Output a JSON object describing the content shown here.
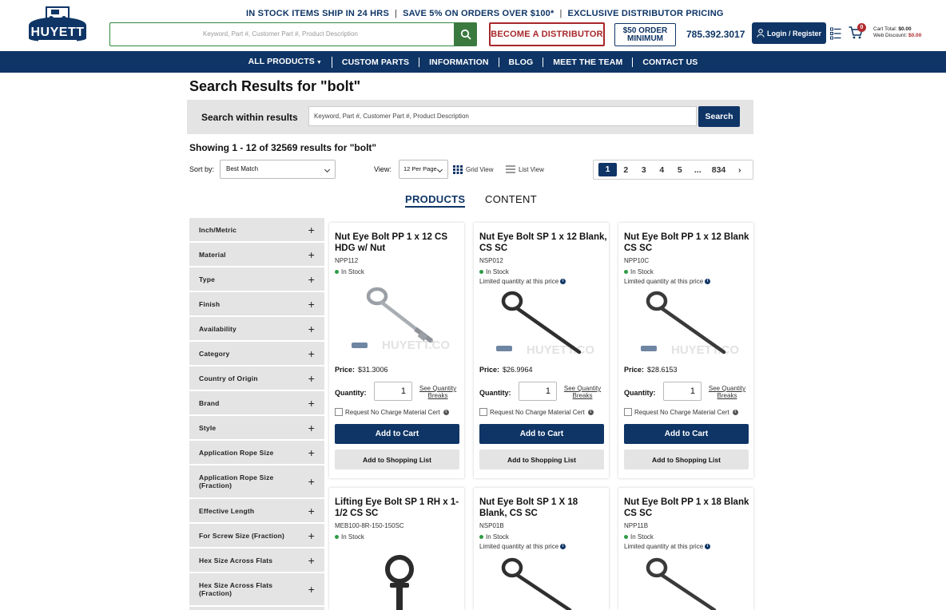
{
  "promo": {
    "item1": "IN STOCK ITEMS SHIP IN 24 HRS",
    "item2": "SAVE 5% ON ORDERS OVER $100*",
    "item3": "EXCLUSIVE DISTRIBUTOR PRICING",
    "sep": "|"
  },
  "header": {
    "search_placeholder": "Keyword, Part #, Customer Part #, Product Description",
    "become_distributor": "BECOME A DISTRIBUTOR",
    "order_min_line1": "$50 ORDER",
    "order_min_line2": "MINIMUM",
    "phone": "785.392.3017",
    "login": "Login / Register",
    "cart_count": "0",
    "cart_total_label": "Cart Total:",
    "cart_total": "$0.00",
    "web_discount_label": "Web Discount:",
    "web_discount": "$0.00"
  },
  "nav": {
    "items": [
      "ALL PRODUCTS",
      "CUSTOM PARTS",
      "INFORMATION",
      "BLOG",
      "MEET THE TEAM",
      "CONTACT US"
    ]
  },
  "page": {
    "title": "Search Results for \"bolt\"",
    "within_label": "Search within results",
    "within_placeholder": "Keyword, Part #, Customer Part #, Product Description",
    "within_button": "Search",
    "showing": "Showing 1 - 12 of 32569 results for \"bolt\"",
    "sort_label": "Sort by:",
    "sort_value": "Best Match",
    "view_label": "View:",
    "per_page": "12 Per Page",
    "grid_view": "Grid View",
    "list_view": "List View",
    "pages": [
      "1",
      "2",
      "3",
      "4",
      "5",
      "...",
      "834"
    ],
    "next": "›",
    "tab_products": "PRODUCTS",
    "tab_content": "CONTENT"
  },
  "filters": [
    "Inch/Metric",
    "Material",
    "Type",
    "Finish",
    "Availability",
    "Category",
    "Country of Origin",
    "Brand",
    "Style",
    "Application Rope Size",
    "Application Rope Size (Fraction)",
    "Effective Length",
    "For Screw Size (Fraction)",
    "Hex Size Across Flats",
    "Hex Size Across Flats (Fraction)"
  ],
  "card_labels": {
    "in_stock": "In Stock",
    "limited": "Limited quantity at this price",
    "price": "Price:",
    "quantity": "Quantity:",
    "qty_breaks": "See Quantity Breaks",
    "cert": "Request No Charge Material Cert",
    "add_cart": "Add to Cart",
    "add_list": "Add to Shopping List",
    "watermark": "HUYETT.COM"
  },
  "products": [
    {
      "title": "Nut Eye Bolt PP 1 x 12 CS HDG w/ Nut",
      "sku": "NPP112",
      "price": "$31.3006",
      "qty": "1",
      "limited": false
    },
    {
      "title": "Nut Eye Bolt SP 1 x 12 Blank, CS SC",
      "sku": "NSP012",
      "price": "$26.9964",
      "qty": "1",
      "limited": true
    },
    {
      "title": "Nut Eye Bolt PP 1 x 12 Blank CS SC",
      "sku": "NPP10C",
      "price": "$28.6153",
      "qty": "1",
      "limited": true
    },
    {
      "title": "Lifting Eye Bolt SP 1 RH x 1-1/2 CS SC",
      "sku": "MEB100-8R-150-150SC",
      "limited": false
    },
    {
      "title": "Nut Eye Bolt SP 1 X 18 Blank, CS SC",
      "sku": "NSP01B",
      "limited": true
    },
    {
      "title": "Nut Eye Bolt PP 1 x 18 Blank CS SC",
      "sku": "NPP11B",
      "limited": true
    }
  ],
  "colors": {
    "navy": "#0f3566",
    "red": "#a8272a",
    "green": "#3b7a3f",
    "stock_dot": "#2e9b45"
  }
}
